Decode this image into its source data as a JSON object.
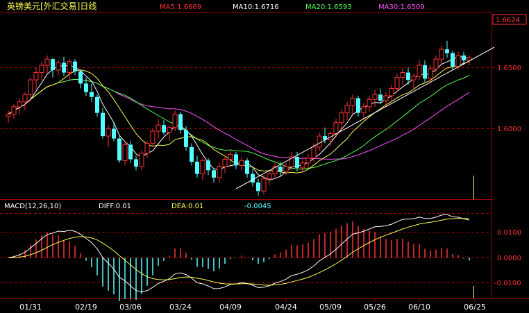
{
  "header": {
    "title": "英镑美元[外汇交易]日线",
    "ma5": "MA5:1.6669",
    "ma10": "MA10:1.6716",
    "ma20": "MA20:1.6593",
    "ma30": "MA30:1.6509"
  },
  "macd_header": {
    "label": "MACD(12,26,10)",
    "diff": "DIFF:0.01",
    "dea": "DEA:0.01",
    "hist": "-0.0045"
  },
  "colors": {
    "up": "#ff3232",
    "down": "#54ffff",
    "ma5": "#ffffff",
    "ma10": "#ffff54",
    "ma20": "#54ff54",
    "ma30": "#ff54ff",
    "grid": "#a00000",
    "axis_text": "#ff3232",
    "header_title": "#ffff54"
  },
  "chart_data": [
    {
      "type": "candlestick",
      "title": "英镑美元[外汇交易]日线",
      "x_ticks": [
        "01/31",
        "02/19",
        "03/06",
        "03/24",
        "04/09",
        "04/24",
        "05/09",
        "05/26",
        "06/10",
        "06/25"
      ],
      "y_ticks": [
        "1.6500",
        "1.6000"
      ],
      "ylim": [
        1.54,
        1.672
      ],
      "last_price": "1.6624",
      "moving_averages": [
        {
          "name": "MA5",
          "last": 1.6669
        },
        {
          "name": "MA10",
          "last": 1.6716
        },
        {
          "name": "MA20",
          "last": 1.6593
        },
        {
          "name": "MA30",
          "last": 1.6509
        }
      ],
      "ohlc": [
        [
          1.61,
          1.615,
          1.605,
          1.612
        ],
        [
          1.612,
          1.62,
          1.608,
          1.618
        ],
        [
          1.618,
          1.625,
          1.612,
          1.622
        ],
        [
          1.622,
          1.63,
          1.615,
          1.628
        ],
        [
          1.628,
          1.642,
          1.622,
          1.64
        ],
        [
          1.64,
          1.65,
          1.632,
          1.646
        ],
        [
          1.646,
          1.655,
          1.64,
          1.652
        ],
        [
          1.652,
          1.66,
          1.645,
          1.657
        ],
        [
          1.657,
          1.658,
          1.642,
          1.648
        ],
        [
          1.648,
          1.656,
          1.644,
          1.654
        ],
        [
          1.654,
          1.659,
          1.643,
          1.646
        ],
        [
          1.646,
          1.657,
          1.64,
          1.655
        ],
        [
          1.655,
          1.657,
          1.644,
          1.647
        ],
        [
          1.647,
          1.648,
          1.633,
          1.637
        ],
        [
          1.637,
          1.642,
          1.627,
          1.63
        ],
        [
          1.63,
          1.637,
          1.622,
          1.626
        ],
        [
          1.626,
          1.628,
          1.61,
          1.613
        ],
        [
          1.613,
          1.617,
          1.592,
          1.594
        ],
        [
          1.594,
          1.603,
          1.585,
          1.6
        ],
        [
          1.6,
          1.606,
          1.59,
          1.592
        ],
        [
          1.592,
          1.595,
          1.572,
          1.574
        ],
        [
          1.574,
          1.59,
          1.57,
          1.587
        ],
        [
          1.587,
          1.59,
          1.572,
          1.575
        ],
        [
          1.575,
          1.578,
          1.566,
          1.569
        ],
        [
          1.569,
          1.582,
          1.566,
          1.58
        ],
        [
          1.58,
          1.59,
          1.576,
          1.588
        ],
        [
          1.588,
          1.6,
          1.585,
          1.598
        ],
        [
          1.598,
          1.608,
          1.592,
          1.603
        ],
        [
          1.603,
          1.607,
          1.595,
          1.597
        ],
        [
          1.597,
          1.603,
          1.59,
          1.601
        ],
        [
          1.601,
          1.615,
          1.598,
          1.612
        ],
        [
          1.612,
          1.614,
          1.596,
          1.599
        ],
        [
          1.599,
          1.602,
          1.582,
          1.585
        ],
        [
          1.585,
          1.588,
          1.57,
          1.573
        ],
        [
          1.573,
          1.578,
          1.56,
          1.563
        ],
        [
          1.563,
          1.576,
          1.558,
          1.574
        ],
        [
          1.574,
          1.576,
          1.562,
          1.566
        ],
        [
          1.566,
          1.568,
          1.556,
          1.56
        ],
        [
          1.56,
          1.572,
          1.556,
          1.569
        ],
        [
          1.569,
          1.578,
          1.564,
          1.575
        ],
        [
          1.575,
          1.582,
          1.57,
          1.579
        ],
        [
          1.579,
          1.581,
          1.567,
          1.57
        ],
        [
          1.57,
          1.577,
          1.566,
          1.574
        ],
        [
          1.574,
          1.576,
          1.56,
          1.563
        ],
        [
          1.563,
          1.567,
          1.553,
          1.556
        ],
        [
          1.556,
          1.559,
          1.545,
          1.549
        ],
        [
          1.549,
          1.562,
          1.546,
          1.559
        ],
        [
          1.559,
          1.566,
          1.554,
          1.563
        ],
        [
          1.563,
          1.572,
          1.56,
          1.569
        ],
        [
          1.569,
          1.573,
          1.561,
          1.565
        ],
        [
          1.565,
          1.572,
          1.562,
          1.569
        ],
        [
          1.569,
          1.581,
          1.566,
          1.577
        ],
        [
          1.577,
          1.581,
          1.565,
          1.568
        ],
        [
          1.568,
          1.575,
          1.564,
          1.572
        ],
        [
          1.572,
          1.579,
          1.568,
          1.576
        ],
        [
          1.576,
          1.588,
          1.573,
          1.585
        ],
        [
          1.585,
          1.597,
          1.582,
          1.594
        ],
        [
          1.594,
          1.601,
          1.588,
          1.591
        ],
        [
          1.591,
          1.598,
          1.586,
          1.596
        ],
        [
          1.596,
          1.608,
          1.593,
          1.605
        ],
        [
          1.605,
          1.616,
          1.6,
          1.613
        ],
        [
          1.613,
          1.622,
          1.607,
          1.619
        ],
        [
          1.619,
          1.628,
          1.612,
          1.625
        ],
        [
          1.625,
          1.627,
          1.61,
          1.613
        ],
        [
          1.613,
          1.621,
          1.607,
          1.618
        ],
        [
          1.618,
          1.627,
          1.614,
          1.624
        ],
        [
          1.624,
          1.632,
          1.618,
          1.628
        ],
        [
          1.628,
          1.633,
          1.62,
          1.623
        ],
        [
          1.623,
          1.63,
          1.618,
          1.627
        ],
        [
          1.627,
          1.636,
          1.622,
          1.633
        ],
        [
          1.633,
          1.645,
          1.63,
          1.642
        ],
        [
          1.642,
          1.65,
          1.636,
          1.646
        ],
        [
          1.646,
          1.65,
          1.636,
          1.64
        ],
        [
          1.64,
          1.645,
          1.633,
          1.643
        ],
        [
          1.643,
          1.656,
          1.64,
          1.652
        ],
        [
          1.652,
          1.656,
          1.638,
          1.641
        ],
        [
          1.641,
          1.652,
          1.637,
          1.649
        ],
        [
          1.649,
          1.66,
          1.646,
          1.657
        ],
        [
          1.657,
          1.668,
          1.653,
          1.665
        ],
        [
          1.665,
          1.672,
          1.658,
          1.662
        ],
        [
          1.662,
          1.664,
          1.648,
          1.651
        ],
        [
          1.651,
          1.663,
          1.648,
          1.66
        ],
        [
          1.66,
          1.663,
          1.652,
          1.656
        ],
        [
          1.656,
          1.66,
          1.652,
          1.658
        ]
      ]
    },
    {
      "type": "macd",
      "title": "MACD(12,26,10)",
      "diff": 0.01,
      "dea": 0.01,
      "histogram_last": -0.0045,
      "y_ticks": [
        "0.0100",
        "0.0000",
        "-0.0100"
      ],
      "ylim": [
        -0.017,
        0.019
      ]
    }
  ]
}
